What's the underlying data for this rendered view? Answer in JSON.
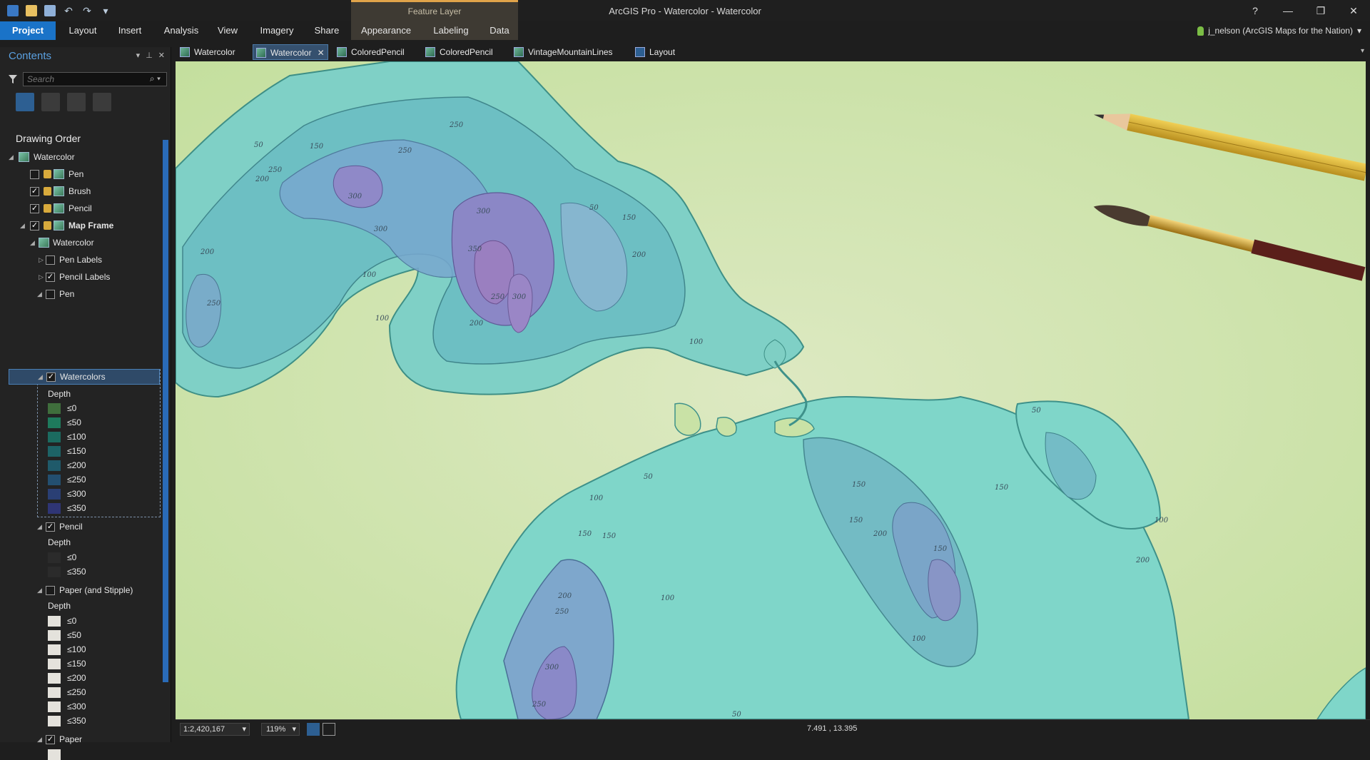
{
  "app_title": "ArcGIS Pro - Watercolor - Watercolor",
  "contextual_tab": "Feature Layer",
  "ribbon_tabs": [
    "Project",
    "Layout",
    "Insert",
    "Analysis",
    "View",
    "Imagery",
    "Share",
    "Appearance",
    "Labeling",
    "Data"
  ],
  "user": "j_nelson (ArcGIS Maps for the Nation)",
  "window_controls": {
    "help": "?",
    "minimize": "—",
    "restore": "❐",
    "close": "✕"
  },
  "contents": {
    "title": "Contents",
    "search_placeholder": "Search",
    "drawing_order": "Drawing Order",
    "rows": [
      {
        "label": "Watercolor"
      },
      {
        "label": "Pen"
      },
      {
        "label": "Brush"
      },
      {
        "label": "Pencil"
      },
      {
        "label": "Map Frame"
      },
      {
        "label": "Watercolor"
      },
      {
        "label": "Pen Labels"
      },
      {
        "label": "Pencil Labels"
      },
      {
        "label": "Pen"
      },
      {
        "label": "Watercolors"
      },
      {
        "label": "Depth"
      },
      {
        "label": "Pencil"
      },
      {
        "label": "Depth"
      },
      {
        "label": "Paper (and Stipple)"
      },
      {
        "label": "Depth"
      },
      {
        "label": "Paper"
      }
    ],
    "watercolor_classes": [
      "≤0",
      "≤50",
      "≤100",
      "≤150",
      "≤200",
      "≤250",
      "≤300",
      "≤350"
    ],
    "watercolor_colors": [
      "#3f6e3c",
      "#1e7a5c",
      "#1b6b60",
      "#1d6366",
      "#1f5a6a",
      "#234f70",
      "#2a3f74",
      "#2f3575"
    ],
    "pencil_classes": [
      "≤0",
      "≤350"
    ],
    "paper_classes": [
      "≤0",
      "≤50",
      "≤100",
      "≤150",
      "≤200",
      "≤250",
      "≤300",
      "≤350"
    ]
  },
  "map_tabs": [
    {
      "label": "Watercolor"
    },
    {
      "label": "Watercolor",
      "close": "✕"
    },
    {
      "label": "ColoredPencil"
    },
    {
      "label": "ColoredPencil"
    },
    {
      "label": "VintageMountainLines"
    },
    {
      "label": "Layout"
    }
  ],
  "map_labels": [
    "50",
    "150",
    "250",
    "250",
    "200",
    "300",
    "300",
    "250",
    "300",
    "350",
    "250",
    "300",
    "200",
    "100",
    "200",
    "150",
    "50",
    "200",
    "250",
    "100",
    "100",
    "50",
    "150",
    "50",
    "100",
    "150",
    "150",
    "150",
    "200",
    "150",
    "100",
    "200",
    "100",
    "150",
    "100",
    "200",
    "250",
    "300",
    "250",
    "50"
  ],
  "status": {
    "scale": "1:2,420,167",
    "zoom": "119%",
    "coords": "7.491 , 13.395"
  }
}
